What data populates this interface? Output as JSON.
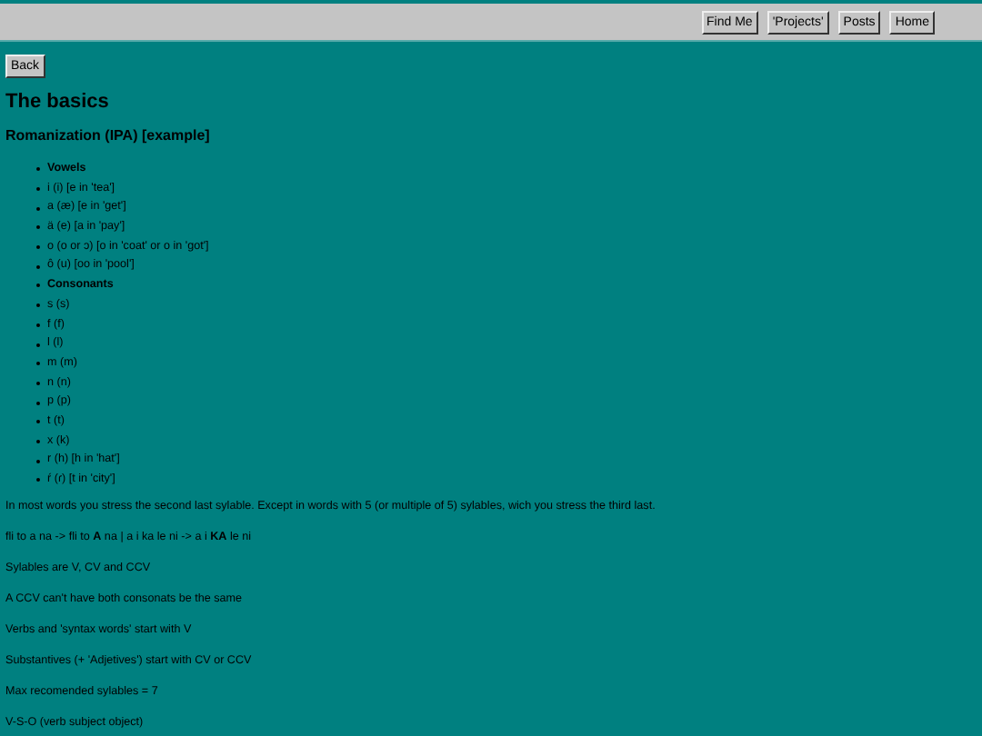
{
  "nav": {
    "buttons": [
      "Find Me",
      "'Projects'",
      "Posts",
      "Home"
    ]
  },
  "back_button": "Back",
  "title": "The basics",
  "subtitle": "Romanization (IPA) [example]",
  "list": [
    {
      "kind": "heading",
      "text": "Vowels"
    },
    {
      "kind": "item",
      "text": "i (i) [e in 'tea']"
    },
    {
      "kind": "item",
      "text": "a (æ) [e in 'get']"
    },
    {
      "kind": "item",
      "text": "ä (e) [a in 'pay']"
    },
    {
      "kind": "item",
      "text": "o (o or ɔ) [o in 'coat' or o in 'got']"
    },
    {
      "kind": "item",
      "text": "ô (u) [oo in 'pool']"
    },
    {
      "kind": "heading",
      "text": "Consonants"
    },
    {
      "kind": "item",
      "text": "s (s)"
    },
    {
      "kind": "item",
      "text": "f (f)"
    },
    {
      "kind": "item",
      "text": "l (l)"
    },
    {
      "kind": "item",
      "text": "m (m)"
    },
    {
      "kind": "item",
      "text": "n (n)"
    },
    {
      "kind": "item",
      "text": "p (p)"
    },
    {
      "kind": "item",
      "text": "t (t)"
    },
    {
      "kind": "item",
      "text": "x (k)"
    },
    {
      "kind": "item",
      "text": "r (h) [h in 'hat']"
    },
    {
      "kind": "item",
      "text": "ŕ (ɾ) [t in 'city']"
    }
  ],
  "paragraphs": [
    "In most words you stress the second last sylable. Except in words with 5 (or multiple of 5) sylables, wich you stress the third last.",
    "fli to a na -> fli to **A** na | a i ka le ni -> a i **KA** le ni",
    "Sylables are V, CV and CCV",
    "A CCV can't have both consonats be the same",
    "Verbs and 'syntax words' start with V",
    "Substantives (+ 'Adjetives') start with CV or CCV",
    "Max recomended sylables = 7",
    "V-S-O (verb subject object)"
  ]
}
